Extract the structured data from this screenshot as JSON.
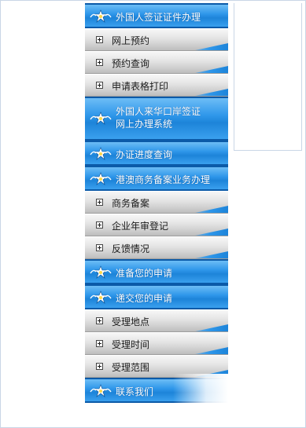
{
  "menu": [
    {
      "type": "category",
      "label": "外国人签证证件办理",
      "icon": "emblem-icon"
    },
    {
      "type": "item",
      "label": "网上预约",
      "icon": "plus-icon"
    },
    {
      "type": "item",
      "label": "预约查询",
      "icon": "plus-icon"
    },
    {
      "type": "item",
      "label": "申请表格打印",
      "icon": "plus-icon"
    },
    {
      "type": "category2",
      "lines": [
        "外国人来华口岸签证",
        "网上办理系统"
      ],
      "icon": "emblem-icon"
    },
    {
      "type": "category",
      "label": "办证进度查询",
      "icon": "emblem-icon"
    },
    {
      "type": "category",
      "label": "港澳商务备案业务办理",
      "icon": "emblem-icon"
    },
    {
      "type": "item",
      "label": "商务备案",
      "icon": "plus-icon"
    },
    {
      "type": "item",
      "label": "企业年审登记",
      "icon": "plus-icon"
    },
    {
      "type": "item",
      "label": "反馈情况",
      "icon": "plus-icon"
    },
    {
      "type": "category",
      "label": "准备您的申请",
      "icon": "emblem-icon"
    },
    {
      "type": "category",
      "label": "递交您的申请",
      "icon": "emblem-icon"
    },
    {
      "type": "item",
      "label": "受理地点",
      "icon": "plus-icon"
    },
    {
      "type": "item",
      "label": "受理时间",
      "icon": "plus-icon"
    },
    {
      "type": "item",
      "label": "受理范围",
      "icon": "plus-icon"
    },
    {
      "type": "category",
      "label": "联系我们",
      "icon": "emblem-icon"
    }
  ],
  "colors": {
    "header_blue": "#2f97ea",
    "header_border": "#0b5aa8",
    "item_gray": "#d6d6d6"
  }
}
